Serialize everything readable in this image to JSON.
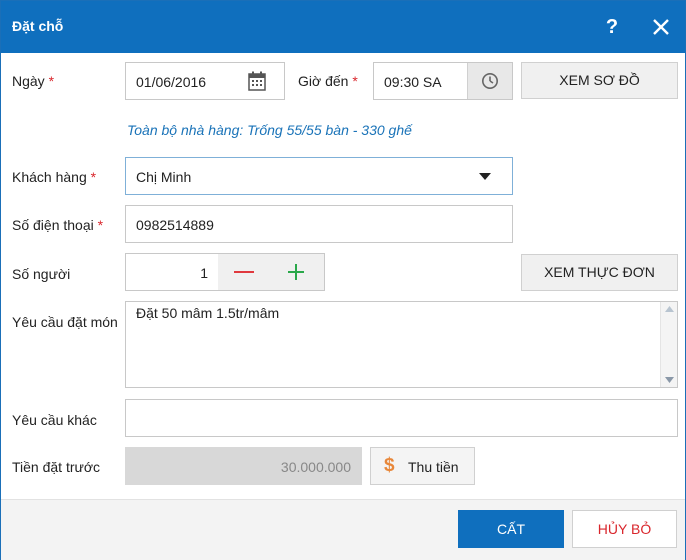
{
  "dialog": {
    "title": "Đặt chỗ",
    "help_label": "?"
  },
  "form": {
    "date_label": "Ngày",
    "required_mark": "*",
    "date_value": "01/06/2016",
    "time_label": "Giờ đến",
    "time_value": "09:30 SA",
    "view_map_label": "XEM SƠ ĐỒ",
    "availability": "Toàn bộ nhà hàng: Trống 55/55 bàn - 330 ghế",
    "customer_label": "Khách hàng",
    "customer_value": "Chị Minh",
    "phone_label": "Số điện thoại",
    "phone_value": "0982514889",
    "guests_label": "Số người",
    "guests_value": "1",
    "view_menu_label": "XEM THỰC ĐƠN",
    "dish_request_label": "Yêu cầu đặt món",
    "dish_request_value": "Đặt 50 mâm 1.5tr/mâm",
    "other_request_label": "Yêu cầu khác",
    "other_request_value": "",
    "deposit_label": "Tiền đặt trước",
    "deposit_value": "30.000.000",
    "collect_label": "Thu tiền"
  },
  "footer": {
    "save_label": "CẤT",
    "cancel_label": "HỦY BỎ"
  },
  "colors": {
    "titlebar": "#0f6fbe",
    "required": "#d9262c",
    "info_text": "#1a73b8",
    "minus": "#e0393e",
    "plus": "#2aa84a",
    "dollar": "#e8873a"
  },
  "icons": {
    "date": "calendar-icon",
    "time": "clock-icon",
    "dropdown": "caret-down-icon",
    "minus": "minus-icon",
    "plus": "plus-icon",
    "collect": "dollar-icon",
    "close": "close-icon"
  }
}
